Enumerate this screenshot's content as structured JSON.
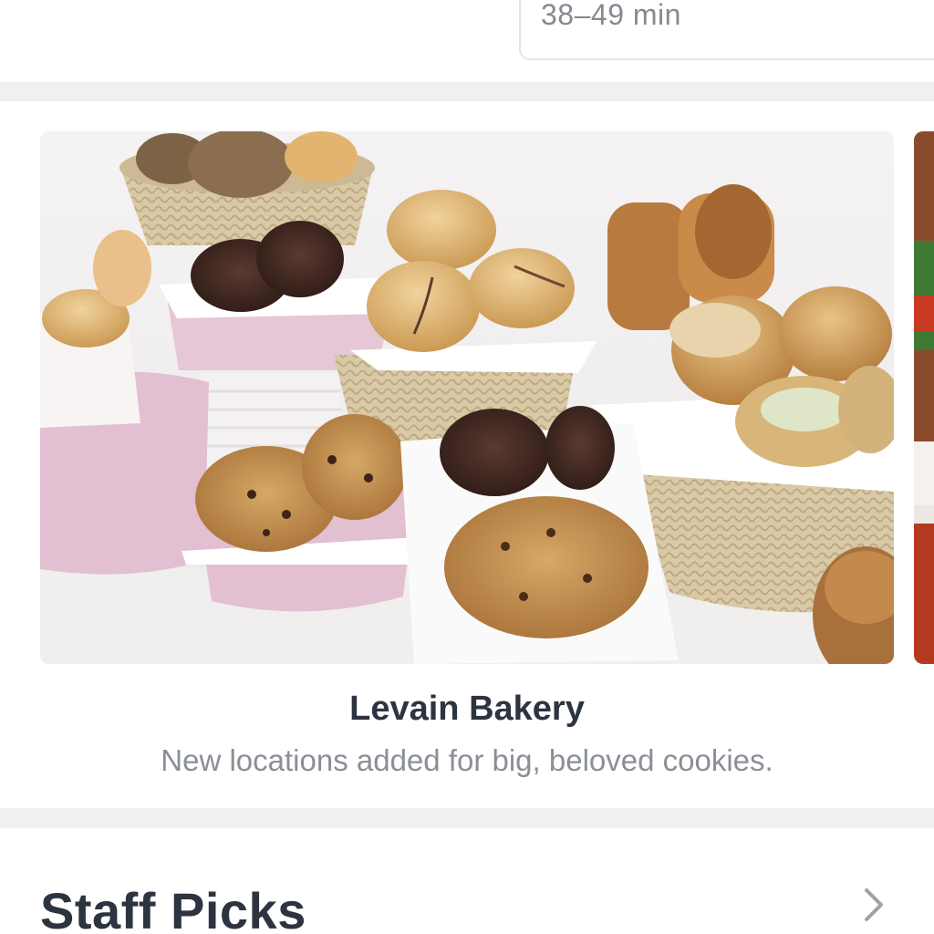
{
  "delivery": {
    "time_estimate": "38–49 min"
  },
  "featured": {
    "store_name": "Levain Bakery",
    "tagline": "New locations added for big, beloved cookies."
  },
  "staff_picks": {
    "title": "Staff Picks"
  },
  "icons": {
    "chevron": "chevron-right-icon"
  },
  "colors": {
    "title_text": "#2c3440",
    "secondary_text": "#8a8f96",
    "separator": "#eff0f2"
  }
}
